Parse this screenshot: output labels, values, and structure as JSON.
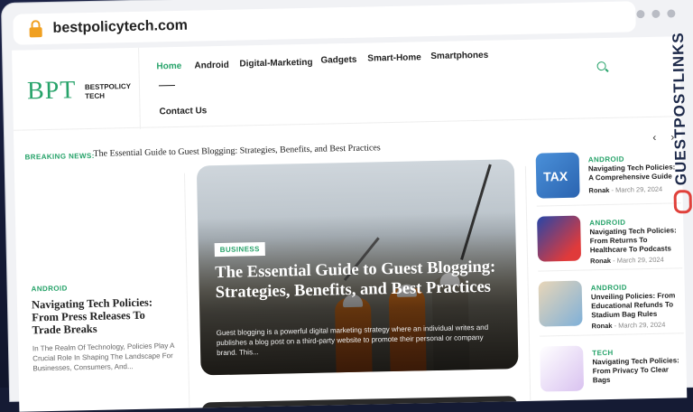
{
  "browser": {
    "url": "bestpolicytech.com"
  },
  "site": {
    "logo_mark": "BPT",
    "logo_line1": "BESTPOLICY",
    "logo_line2": "TECH"
  },
  "nav": {
    "items": [
      "Home",
      "Android",
      "Digital-Marketing",
      "Gadgets",
      "Smart-Home",
      "Smartphones",
      "Contact Us"
    ],
    "active": "Home"
  },
  "breaking": {
    "label": "BREAKING NEWS:",
    "headline": "The Essential Guide to Guest Blogging: Strategies, Benefits, and Best Practices"
  },
  "left_article": {
    "category": "ANDROID",
    "title": "Navigating Tech Policies: From Press Releases To Trade Breaks",
    "excerpt": "In The Realm Of Technology, Policies Play A Crucial Role In Shaping The Landscape For Businesses, Consumers, And..."
  },
  "hero": {
    "category": "BUSINESS",
    "title": "The Essential Guide to Guest Blogging: Strategies, Benefits, and Best Practices",
    "excerpt": "Guest blogging is a powerful digital marketing strategy where an individual writes and publishes a blog post on a third-party website to promote their personal or company brand. This..."
  },
  "sidebar": [
    {
      "category": "ANDROID",
      "title": "Navigating Tech Policies: A Comprehensive Guide",
      "author": "Ronak",
      "date": "March 29, 2024",
      "thumb_text": "TAX"
    },
    {
      "category": "ANDROID",
      "title": "Navigating Tech Policies: From Returns To Healthcare To Podcasts",
      "author": "Ronak",
      "date": "March 29, 2024"
    },
    {
      "category": "ANDROID",
      "title": "Unveiling Policies: From Educational Refunds To Stadium Bag Rules",
      "author": "Ronak",
      "date": "March 29, 2024"
    },
    {
      "category": "TECH",
      "title": "Navigating Tech Policies: From Privacy To Clear Bags"
    }
  ],
  "watermark": "GUESTPOSTLINKS",
  "colors": {
    "accent": "#27a36a",
    "brand_dark": "#1e2a4a",
    "brand_red": "#e0413b"
  }
}
